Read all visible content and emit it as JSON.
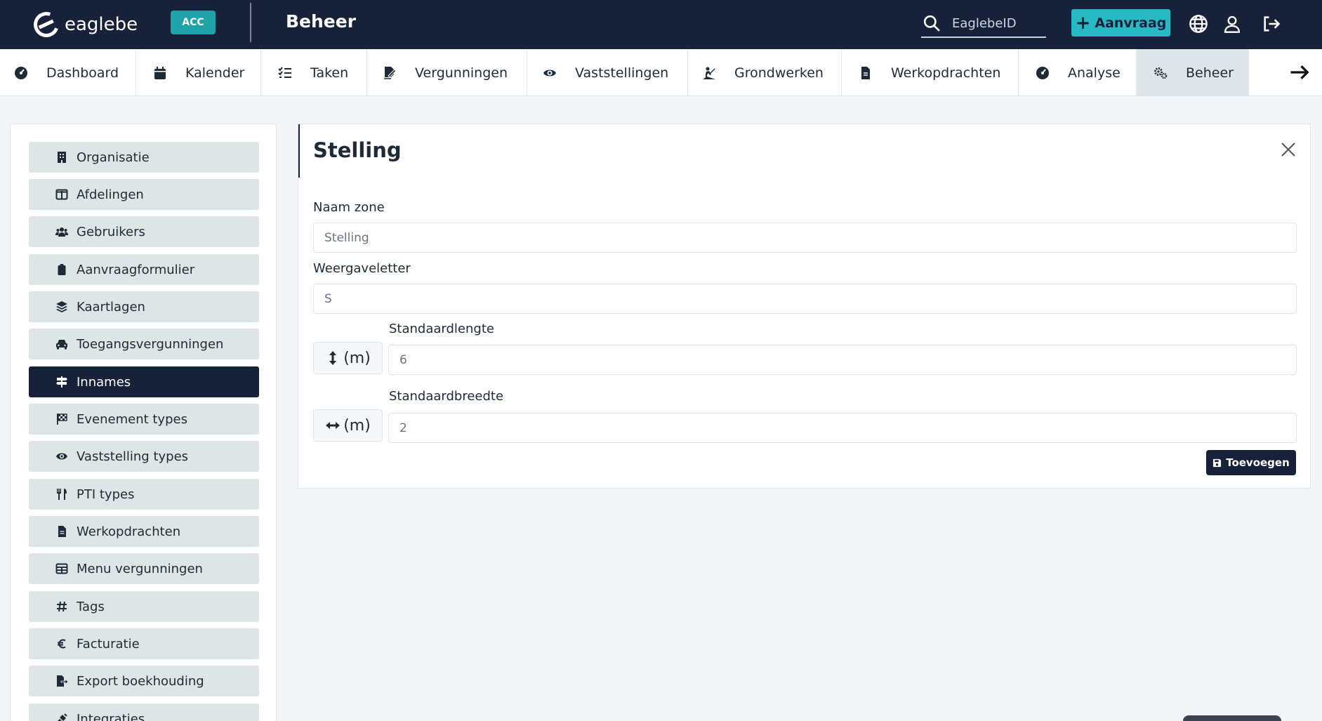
{
  "header": {
    "logo_text": "eaglebe",
    "env_badge": "ACC",
    "title": "Beheer",
    "search": {
      "placeholder": "EaglebeID"
    },
    "aanvraag_label": "Aanvraag",
    "icons": [
      "globe-icon",
      "user-icon",
      "logout-icon"
    ]
  },
  "nav": {
    "items": [
      {
        "label": "Dashboard",
        "icon": "dashboard-icon"
      },
      {
        "label": "Kalender",
        "icon": "calendar-icon"
      },
      {
        "label": "Taken",
        "icon": "tasks-icon"
      },
      {
        "label": "Vergunningen",
        "icon": "signature-icon"
      },
      {
        "label": "Vaststellingen",
        "icon": "eye-icon"
      },
      {
        "label": "Grondwerken",
        "icon": "digging-icon"
      },
      {
        "label": "Werkopdrachten",
        "icon": "document-icon"
      },
      {
        "label": "Analyse",
        "icon": "analytics-icon"
      },
      {
        "label": "Beheer",
        "icon": "cogs-icon",
        "active": true
      }
    ]
  },
  "sidebar": {
    "items": [
      {
        "label": "Organisatie",
        "icon": "building-icon"
      },
      {
        "label": "Afdelingen",
        "icon": "columns-icon"
      },
      {
        "label": "Gebruikers",
        "icon": "users-icon"
      },
      {
        "label": "Aanvraagformulier",
        "icon": "clipboard-icon"
      },
      {
        "label": "Kaartlagen",
        "icon": "layers-icon"
      },
      {
        "label": "Toegangsvergunningen",
        "icon": "car-icon"
      },
      {
        "label": "Innames",
        "icon": "signs-icon",
        "active": true
      },
      {
        "label": "Evenement types",
        "icon": "flag-checkered-icon"
      },
      {
        "label": "Vaststelling types",
        "icon": "eye-icon"
      },
      {
        "label": "PTI types",
        "icon": "utensils-icon"
      },
      {
        "label": "Werkopdrachten",
        "icon": "document-icon"
      },
      {
        "label": "Menu vergunningen",
        "icon": "table-icon"
      },
      {
        "label": "Tags",
        "icon": "hashtag-icon"
      },
      {
        "label": "Facturatie",
        "icon": "euro-icon"
      },
      {
        "label": "Export boekhouding",
        "icon": "file-export-icon"
      },
      {
        "label": "Integraties",
        "icon": "plug-icon"
      }
    ]
  },
  "form": {
    "title": "Stelling",
    "fields": {
      "naam_zone": {
        "label": "Naam zone",
        "value": "Stelling"
      },
      "weergaveletter": {
        "label": "Weergaveletter",
        "value": "S"
      },
      "standaardlengte": {
        "label": "Standaardlengte",
        "value": "6",
        "unit": "(m)"
      },
      "standaardbreedte": {
        "label": "Standaardbreedte",
        "value": "2",
        "unit": "(m)"
      }
    },
    "submit_label": "Toevoegen"
  },
  "colors": {
    "navy": "#17213a",
    "teal": "#27b9c4",
    "sidebar_item": "#dde5e6",
    "active_nav": "#dfe6e9"
  }
}
